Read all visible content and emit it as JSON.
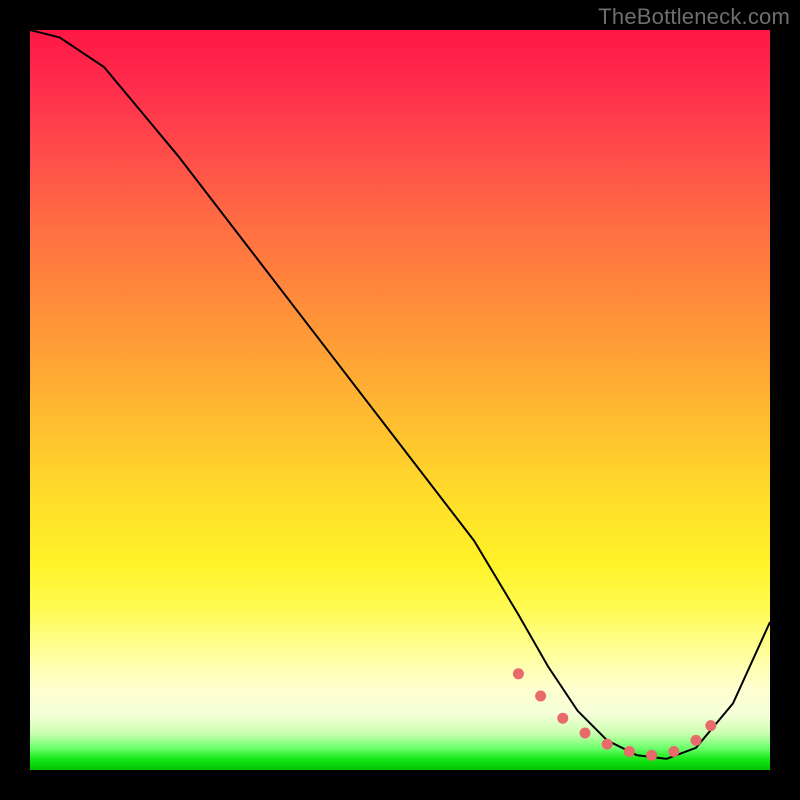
{
  "watermark": "TheBottleneck.com",
  "chart_data": {
    "type": "line",
    "title": "",
    "xlabel": "",
    "ylabel": "",
    "xlim": [
      0,
      100
    ],
    "ylim": [
      0,
      100
    ],
    "series": [
      {
        "name": "bottleneck-curve",
        "x": [
          0,
          4,
          10,
          20,
          30,
          40,
          50,
          60,
          66,
          70,
          74,
          78,
          82,
          86,
          90,
          95,
          100
        ],
        "values": [
          100,
          99,
          95,
          83,
          70,
          57,
          44,
          31,
          21,
          14,
          8,
          4,
          2,
          1.5,
          3,
          9,
          20
        ]
      }
    ],
    "markers": {
      "name": "highlight-dots",
      "x": [
        66,
        69,
        72,
        75,
        78,
        81,
        84,
        87,
        90,
        92
      ],
      "values": [
        13,
        10,
        7,
        5,
        3.5,
        2.5,
        2,
        2.5,
        4,
        6
      ]
    },
    "background": {
      "type": "vertical-gradient",
      "stops": [
        {
          "pos": 0,
          "color": "#ff1744"
        },
        {
          "pos": 50,
          "color": "#ffae33"
        },
        {
          "pos": 78,
          "color": "#fffb50"
        },
        {
          "pos": 92,
          "color": "#f4ffd8"
        },
        {
          "pos": 100,
          "color": "#00c400"
        }
      ]
    }
  }
}
